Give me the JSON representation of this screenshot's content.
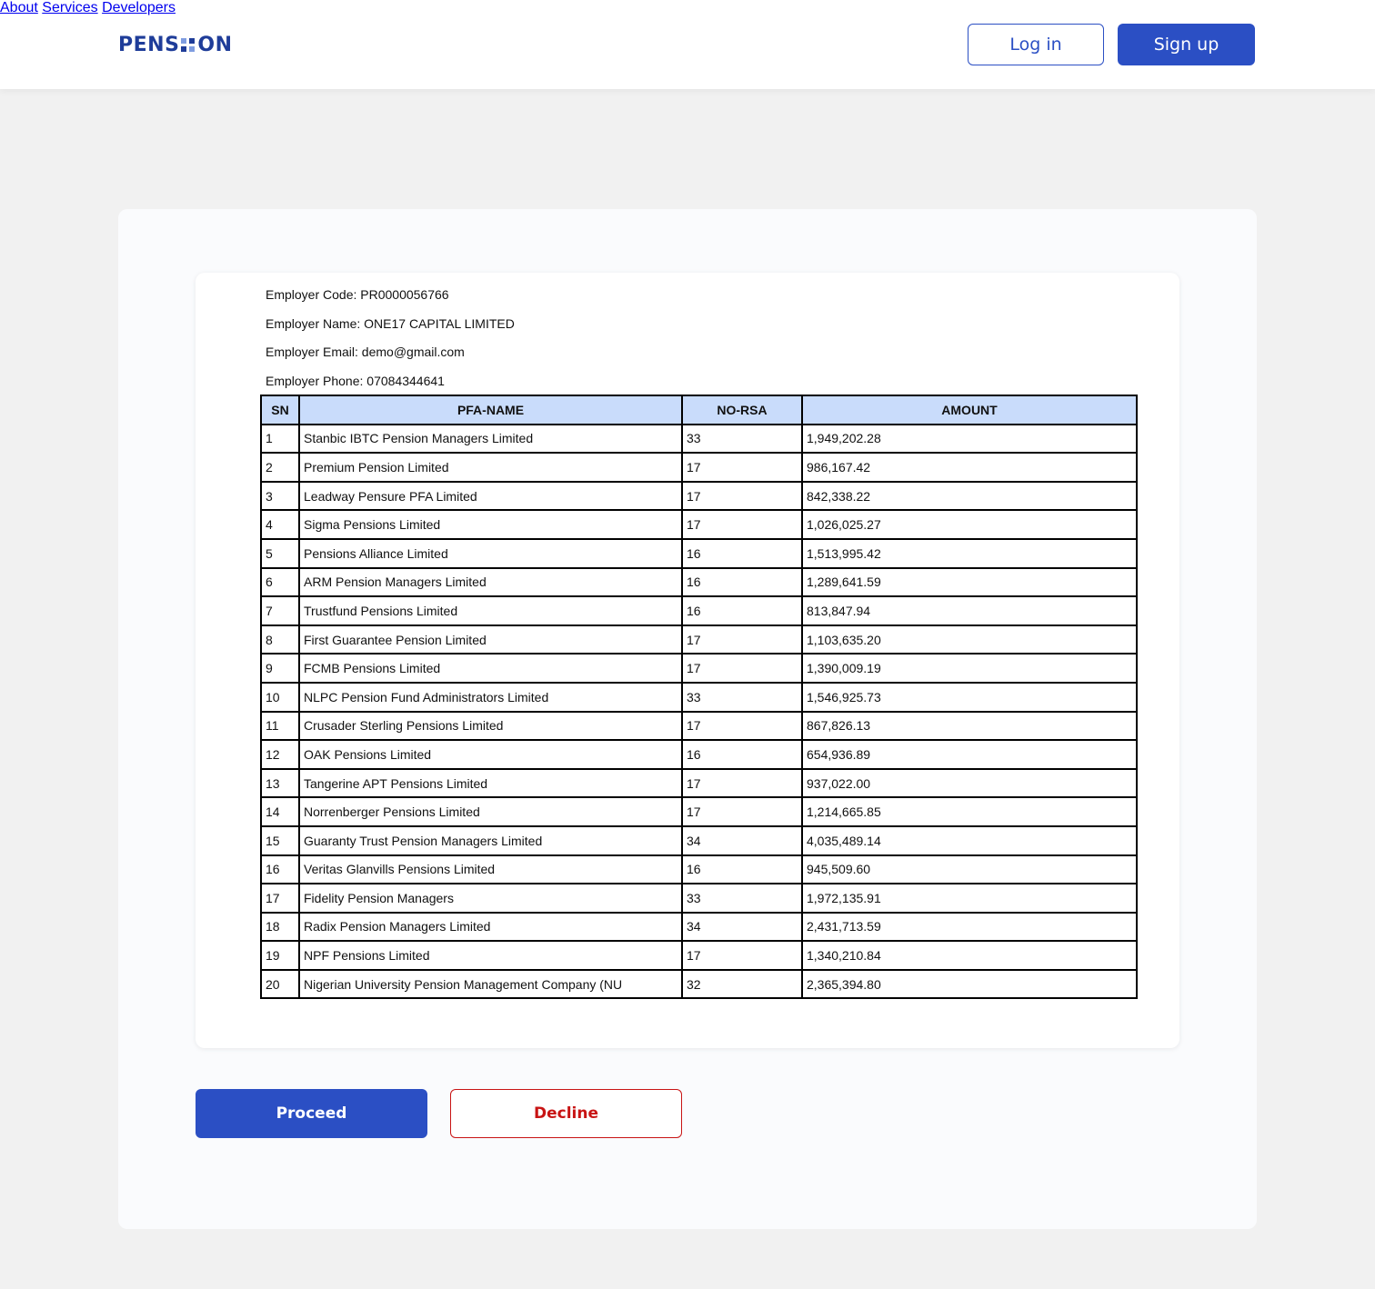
{
  "header": {
    "logo_left": "PENS",
    "logo_right": "ON",
    "nav": [
      "About",
      "Services",
      "Developers"
    ],
    "login_label": "Log in",
    "signup_label": "Sign up"
  },
  "employer": {
    "code": "Employer Code: PR0000056766",
    "name": "Employer Name: ONE17 CAPITAL LIMITED",
    "email": "Employer Email: demo@gmail.com",
    "phone": "Employer Phone: 07084344641"
  },
  "table": {
    "headers": [
      "SN",
      "PFA-NAME",
      "NO-RSA",
      "AMOUNT"
    ],
    "rows": [
      [
        "1",
        "Stanbic IBTC Pension Managers Limited",
        "33",
        "1,949,202.28"
      ],
      [
        "2",
        "Premium Pension Limited",
        "17",
        "986,167.42"
      ],
      [
        "3",
        "Leadway Pensure PFA Limited",
        "17",
        "842,338.22"
      ],
      [
        "4",
        "Sigma Pensions Limited",
        "17",
        "1,026,025.27"
      ],
      [
        "5",
        "Pensions Alliance Limited",
        "16",
        "1,513,995.42"
      ],
      [
        "6",
        "ARM Pension Managers Limited",
        "16",
        "1,289,641.59"
      ],
      [
        "7",
        "Trustfund Pensions Limited",
        "16",
        "813,847.94"
      ],
      [
        "8",
        "First Guarantee Pension Limited",
        "17",
        "1,103,635.20"
      ],
      [
        "9",
        "FCMB Pensions Limited",
        "17",
        "1,390,009.19"
      ],
      [
        "10",
        "NLPC Pension Fund Administrators Limited",
        "33",
        "1,546,925.73"
      ],
      [
        "11",
        "Crusader Sterling Pensions Limited",
        "17",
        "867,826.13"
      ],
      [
        "12",
        "OAK Pensions Limited",
        "16",
        "654,936.89"
      ],
      [
        "13",
        "Tangerine APT Pensions Limited",
        "17",
        "937,022.00"
      ],
      [
        "14",
        "Norrenberger Pensions Limited",
        "17",
        "1,214,665.85"
      ],
      [
        "15",
        "Guaranty Trust Pension Managers Limited",
        "34",
        "4,035,489.14"
      ],
      [
        "16",
        "Veritas Glanvills Pensions Limited",
        "16",
        "945,509.60"
      ],
      [
        "17",
        "Fidelity Pension Managers",
        "33",
        "1,972,135.91"
      ],
      [
        "18",
        "Radix Pension Managers Limited",
        "34",
        "2,431,713.59"
      ],
      [
        "19",
        "NPF Pensions Limited",
        "17",
        "1,340,210.84"
      ],
      [
        "20",
        "Nigerian University Pension Management Company (NU",
        "32",
        "2,365,394.80"
      ]
    ]
  },
  "actions": {
    "proceed_label": "Proceed",
    "decline_label": "Decline"
  },
  "colors": {
    "brand": "#2b4fc4",
    "logo": "#1f3d99",
    "decline": "#c81414",
    "table_header_bg": "#c9dcfb"
  }
}
